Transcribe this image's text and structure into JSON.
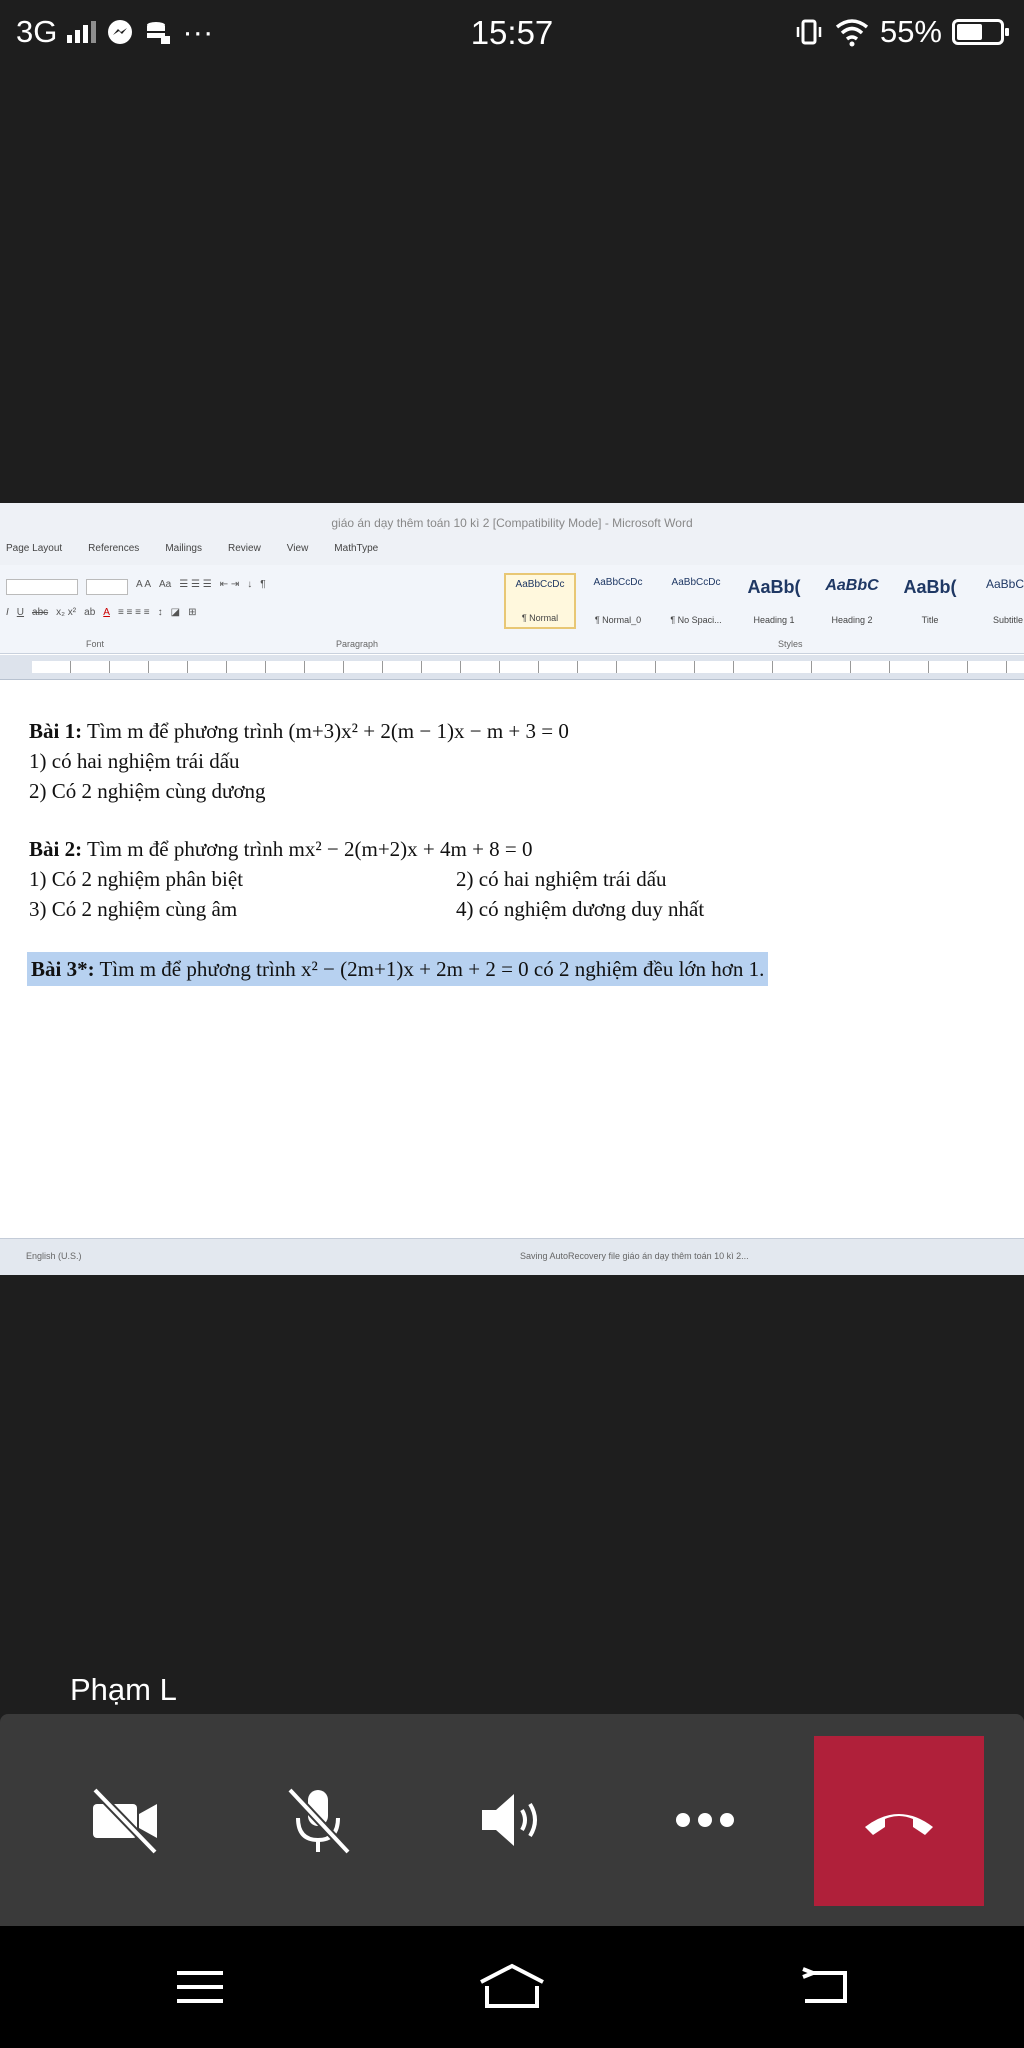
{
  "status": {
    "network": "3G",
    "time": "15:57",
    "battery": "55%",
    "battery_level": 0.55
  },
  "word": {
    "window_title": "giáo án dạy thêm toán 10 kì 2 [Compatibility Mode] - Microsoft Word",
    "menu": [
      "Page Layout",
      "References",
      "Mailings",
      "Review",
      "View",
      "MathType"
    ],
    "group_labels": {
      "font": "Font",
      "paragraph": "Paragraph",
      "styles": "Styles"
    },
    "styles": [
      {
        "sample": "AaBbCcDc",
        "name": "¶ Normal"
      },
      {
        "sample": "AaBbCcDc",
        "name": "¶ Normal_0"
      },
      {
        "sample": "AaBbCcDc",
        "name": "¶ No Spaci..."
      },
      {
        "sample": "AaBb(",
        "name": "Heading 1"
      },
      {
        "sample": "AaBbC",
        "name": "Heading 2"
      },
      {
        "sample": "AaBb(",
        "name": "Title"
      },
      {
        "sample": "AaBbCc",
        "name": "Subtitle"
      }
    ],
    "status_language": "English (U.S.)",
    "status_center": "Saving AutoRecovery file giáo án dạy thêm toán 10 kì 2..."
  },
  "doc": {
    "bai1_label": "Bài 1:",
    "bai1_text": " Tìm m để phương trình (m+3)x² + 2(m − 1)x − m + 3 = 0",
    "bai1_1": "1) có hai nghiệm trái dấu",
    "bai1_2": "2) Có 2 nghiệm cùng dương",
    "bai2_label": "Bài 2:",
    "bai2_text": " Tìm m để phương trình mx² − 2(m+2)x + 4m + 8 = 0",
    "bai2_1": "1) Có 2 nghiệm phân biệt",
    "bai2_2": "2) có hai nghiệm trái dấu",
    "bai2_3": "3) Có 2 nghiệm cùng âm",
    "bai2_4": "4) có nghiệm dương duy nhất",
    "bai3_label": "Bài 3*:",
    "bai3_text": " Tìm m để phương trình x² − (2m+1)x + 2m + 2 = 0  có 2 nghiệm đều lớn hơn 1."
  },
  "call": {
    "participant": "Phạm L",
    "end_color": "#b0203a"
  }
}
